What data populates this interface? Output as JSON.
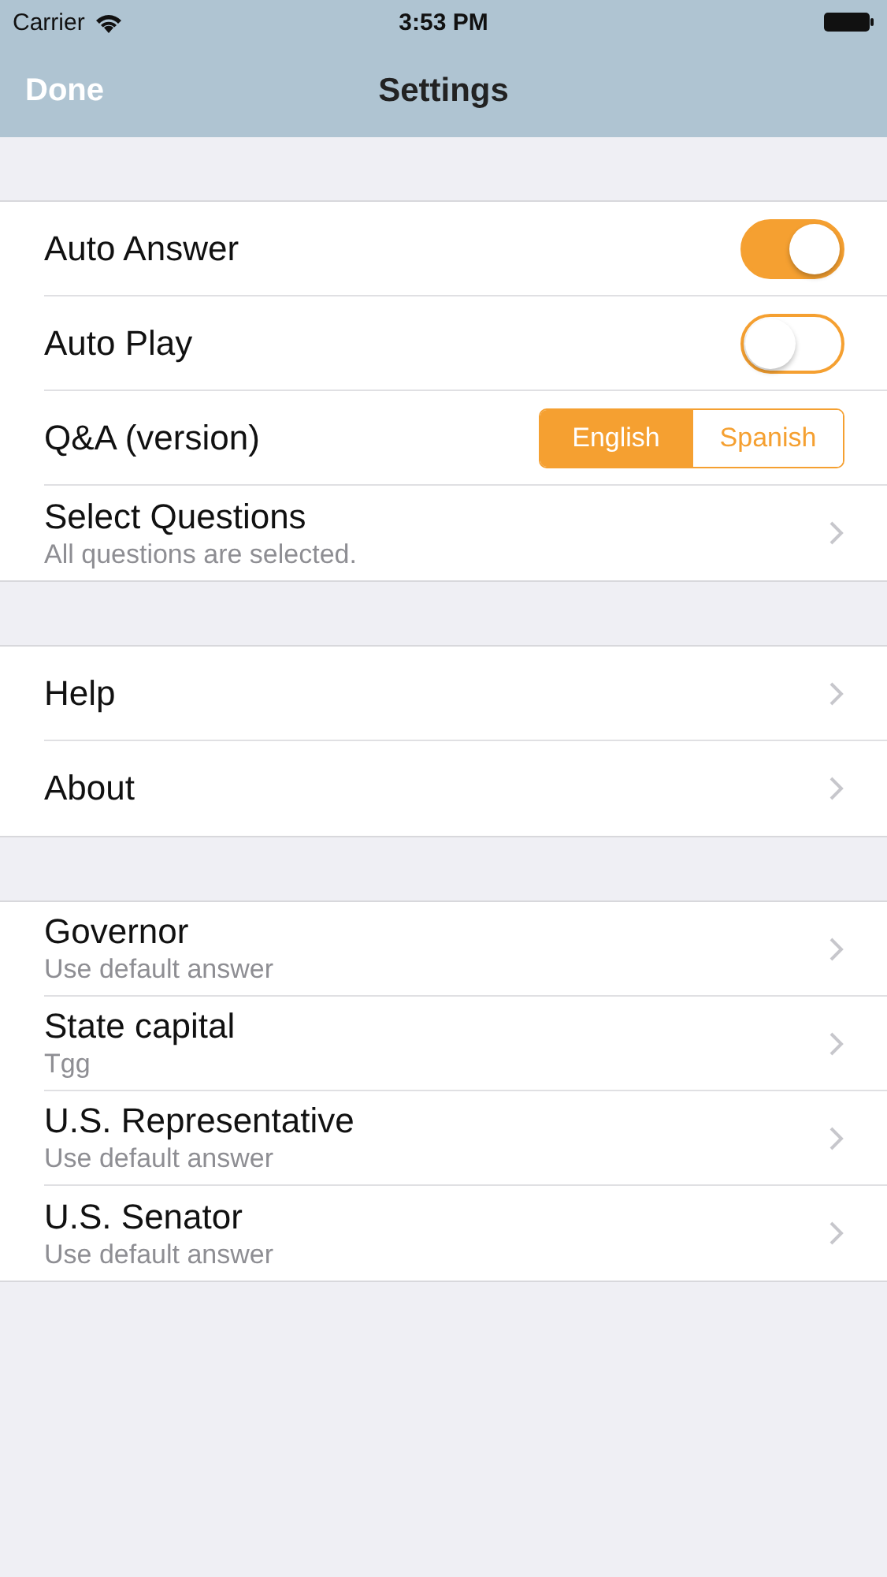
{
  "status_bar": {
    "carrier": "Carrier",
    "time": "3:53 PM"
  },
  "nav": {
    "left_button": "Done",
    "title": "Settings"
  },
  "groups": [
    {
      "rows": [
        {
          "kind": "toggle",
          "label": "Auto Answer",
          "on": true
        },
        {
          "kind": "toggle",
          "label": "Auto Play",
          "on": false
        },
        {
          "kind": "segmented",
          "label": "Q&A (version)",
          "segments": [
            {
              "label": "English",
              "selected": true
            },
            {
              "label": "Spanish",
              "selected": false
            }
          ]
        },
        {
          "kind": "link",
          "label": "Select Questions",
          "subtitle": "All questions are selected."
        }
      ]
    },
    {
      "rows": [
        {
          "kind": "link",
          "label": "Help"
        },
        {
          "kind": "link",
          "label": "About"
        }
      ]
    },
    {
      "rows": [
        {
          "kind": "link",
          "label": "Governor",
          "subtitle": "Use default answer"
        },
        {
          "kind": "link",
          "label": "State capital",
          "subtitle": "Tgg"
        },
        {
          "kind": "link",
          "label": "U.S. Representative",
          "subtitle": "Use default answer"
        },
        {
          "kind": "link",
          "label": "U.S. Senator",
          "subtitle": "Use default answer"
        }
      ]
    }
  ]
}
